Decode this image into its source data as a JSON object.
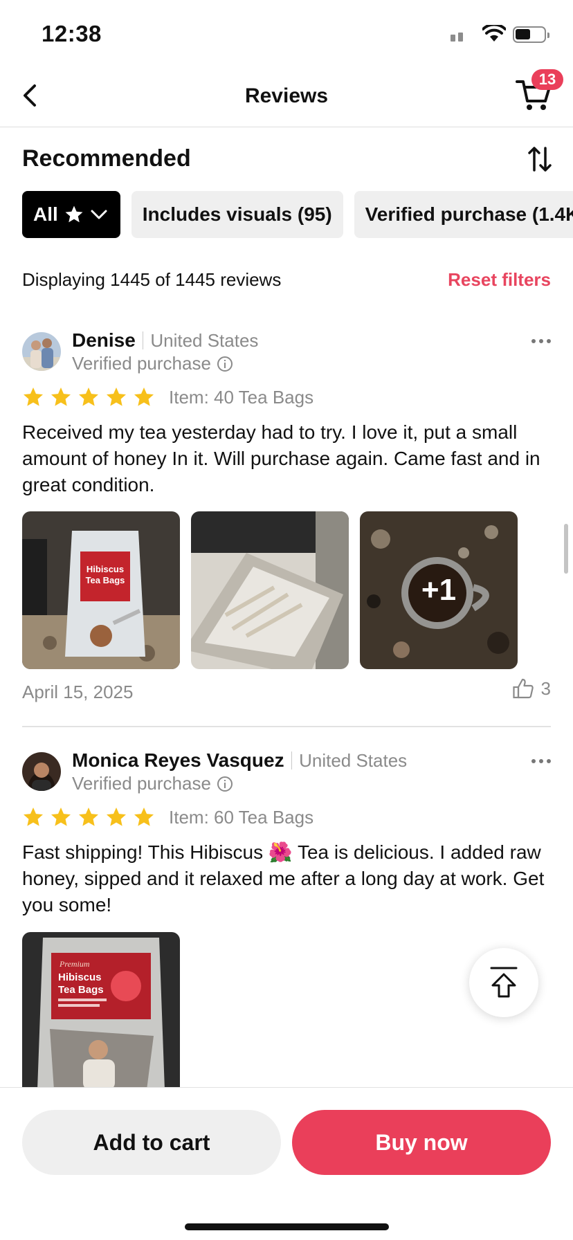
{
  "status_bar": {
    "time": "12:38"
  },
  "header": {
    "title": "Reviews",
    "cart_count": "13"
  },
  "sort": {
    "label": "Recommended"
  },
  "filters": {
    "all_label": "All",
    "chips": [
      "Includes visuals (95)",
      "Verified purchase (1.4K)"
    ]
  },
  "summary": {
    "text": "Displaying 1445 of 1445 reviews",
    "reset_label": "Reset filters"
  },
  "reviews": [
    {
      "name": "Denise",
      "country": "United States",
      "verified": "Verified purchase",
      "rating": 5,
      "item": "Item: 40 Tea Bags",
      "text": "Received my tea yesterday had to try. I love it, put a small amount of honey In it. Will purchase again. Came fast and in great condition.",
      "extra_photos": "+1",
      "date": "April 15, 2025",
      "likes": "3"
    },
    {
      "name": "Monica Reyes Vasquez",
      "country": "United States",
      "verified": "Verified purchase",
      "rating": 5,
      "item": "Item: 60 Tea Bags",
      "text": "Fast shipping! This Hibiscus 🌺 Tea is delicious. I added raw honey, sipped and it relaxed me after a long day at work. Get you some!"
    }
  ],
  "product_label": {
    "brand": "Premium",
    "line1": "Hibiscus",
    "line2": "Tea Bags"
  },
  "actions": {
    "add_to_cart": "Add to cart",
    "buy_now": "Buy now"
  },
  "colors": {
    "accent": "#ea3f5a",
    "star": "#f7c01b",
    "muted": "#8a8a8a"
  }
}
